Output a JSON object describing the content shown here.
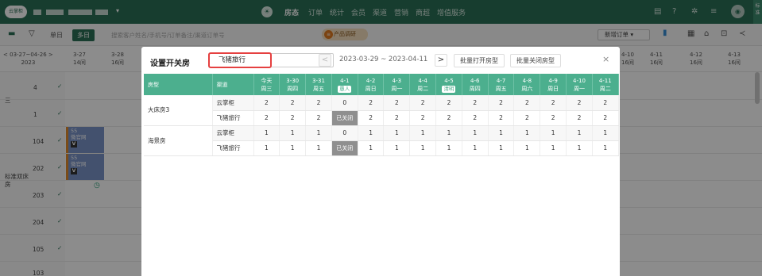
{
  "app": {
    "logo_text": "云掌柜"
  },
  "topnav": {
    "items": [
      {
        "label": "房态",
        "active": true
      },
      {
        "label": "订单",
        "active": false
      },
      {
        "label": "统计",
        "active": false
      },
      {
        "label": "会员",
        "active": false
      },
      {
        "label": "渠道",
        "active": false
      },
      {
        "label": "营销",
        "active": false
      },
      {
        "label": "商超",
        "active": false
      },
      {
        "label": "增值服务",
        "active": false
      }
    ],
    "side_label": "标准"
  },
  "toolbar": {
    "single_label": "单日",
    "multi_label": "多日",
    "search_placeholder": "搜索客户姓名/手机号/订单备注/渠道订单号",
    "promo_label": "产品调研",
    "add_order_label": "新增订单 ▾"
  },
  "calendar": {
    "range_label": "03-27~04-26",
    "range_year": "2023",
    "columns": [
      {
        "date": "3-27",
        "day": "14间"
      },
      {
        "date": "3-28",
        "day": "16间"
      },
      {
        "date": "4-10",
        "day": "16间"
      },
      {
        "date": "4-11",
        "day": "16间"
      },
      {
        "date": "4-12",
        "day": "16间"
      },
      {
        "date": "4-13",
        "day": "16间"
      }
    ],
    "rows": [
      {
        "num": "4"
      },
      {
        "num": "1"
      },
      {
        "num": "104"
      },
      {
        "num": "202"
      },
      {
        "num": "203"
      },
      {
        "num": "204"
      },
      {
        "num": "105"
      },
      {
        "num": "103"
      }
    ],
    "group_labels": {
      "g1": "三",
      "g2": "标准双床房"
    },
    "bookings": [
      {
        "code": "55",
        "source": "微官网",
        "badge": "V"
      },
      {
        "code": "55",
        "source": "微官网",
        "badge": "V"
      }
    ]
  },
  "modal": {
    "title": "设置开关房",
    "channel_select": "飞猪旅行",
    "date_range": "2023-03-29 ~ 2023-04-11",
    "batch_open_label": "批量打开房型",
    "batch_close_label": "批量关闭房型",
    "close_label": "×",
    "headers": {
      "room_type": "房型",
      "channel": "渠道"
    },
    "dates": [
      {
        "d": "今天",
        "w": "周三"
      },
      {
        "d": "3-30",
        "w": "周四"
      },
      {
        "d": "3-31",
        "w": "周五"
      },
      {
        "d": "4-1",
        "w": "愚人",
        "tag": true
      },
      {
        "d": "4-2",
        "w": "周日"
      },
      {
        "d": "4-3",
        "w": "周一"
      },
      {
        "d": "4-4",
        "w": "周二"
      },
      {
        "d": "4-5",
        "w": "清明",
        "tag": true
      },
      {
        "d": "4-6",
        "w": "周四"
      },
      {
        "d": "4-7",
        "w": "周五"
      },
      {
        "d": "4-8",
        "w": "周六"
      },
      {
        "d": "4-9",
        "w": "周日"
      },
      {
        "d": "4-10",
        "w": "周一"
      },
      {
        "d": "4-11",
        "w": "周二"
      }
    ],
    "rooms": [
      {
        "name": "大床房3",
        "channels": [
          {
            "name": "云掌柜",
            "values": [
              "2",
              "2",
              "2",
              "0",
              "2",
              "2",
              "2",
              "2",
              "2",
              "2",
              "2",
              "2",
              "2",
              "2"
            ]
          },
          {
            "name": "飞猪旅行",
            "values": [
              "2",
              "2",
              "2",
              "已关闭",
              "2",
              "2",
              "2",
              "2",
              "2",
              "2",
              "2",
              "2",
              "2",
              "2"
            ]
          }
        ]
      },
      {
        "name": "海景房",
        "channels": [
          {
            "name": "云掌柜",
            "values": [
              "1",
              "1",
              "1",
              "0",
              "1",
              "1",
              "1",
              "1",
              "1",
              "1",
              "1",
              "1",
              "1",
              "1"
            ]
          },
          {
            "name": "飞猪旅行",
            "values": [
              "1",
              "1",
              "1",
              "已关闭",
              "1",
              "1",
              "1",
              "1",
              "1",
              "1",
              "1",
              "1",
              "1",
              "1"
            ]
          }
        ]
      }
    ]
  }
}
